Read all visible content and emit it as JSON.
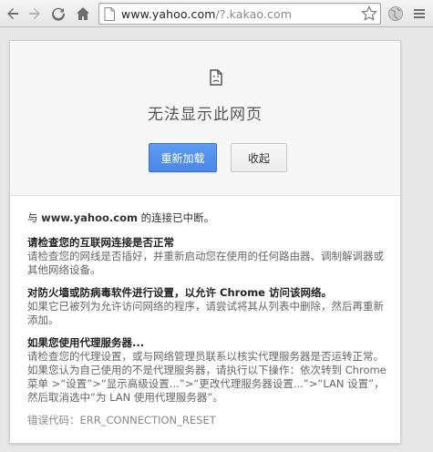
{
  "browser": {
    "url_host": "www.yahoo.com",
    "url_rest": "/?.kakao.com",
    "icons": {
      "back": "back-arrow-icon",
      "forward": "forward-arrow-icon",
      "reload": "reload-icon",
      "home": "home-icon",
      "page": "page-icon",
      "star": "star-icon",
      "globe": "globe-icon",
      "menu": "menu-icon"
    }
  },
  "error": {
    "icon": "sad-page-icon",
    "title": "无法显示此网页",
    "reload_label": "重新加载",
    "hide_label": "收起",
    "intro_prefix": "与 ",
    "intro_host": "www.yahoo.com",
    "intro_suffix": " 的连接已中断。",
    "sections": [
      {
        "head": "请检查您的互联网连接是否正常",
        "body": "请检查您的网线是否插好，并重新启动您在使用的任何路由器、调制解调器或其他网络设备。"
      },
      {
        "head": "对防火墙或防病毒软件进行设置，以允许 Chrome 访问该网络。",
        "body": "如果它已被列为允许访问网络的程序，请尝试将其从列表中删除，然后再重新添加。"
      },
      {
        "head": "如果您使用代理服务器...",
        "body": "请检查您的代理设置，或与网络管理员联系以核实代理服务器是否运转正常。如果您认为自己使用的不是代理服务器，请执行以下操作：依次转到 Chrome 菜单 >“设置”>“显示高级设置...”>“更改代理服务器设置...”>“LAN 设置”，然后取消选中“为 LAN 使用代理服务器”。"
      }
    ],
    "error_code": "错误代码：ERR_CONNECTION_RESET"
  },
  "colors": {
    "accent": "#4a87e8",
    "page_bg": "#e8e8e8"
  }
}
